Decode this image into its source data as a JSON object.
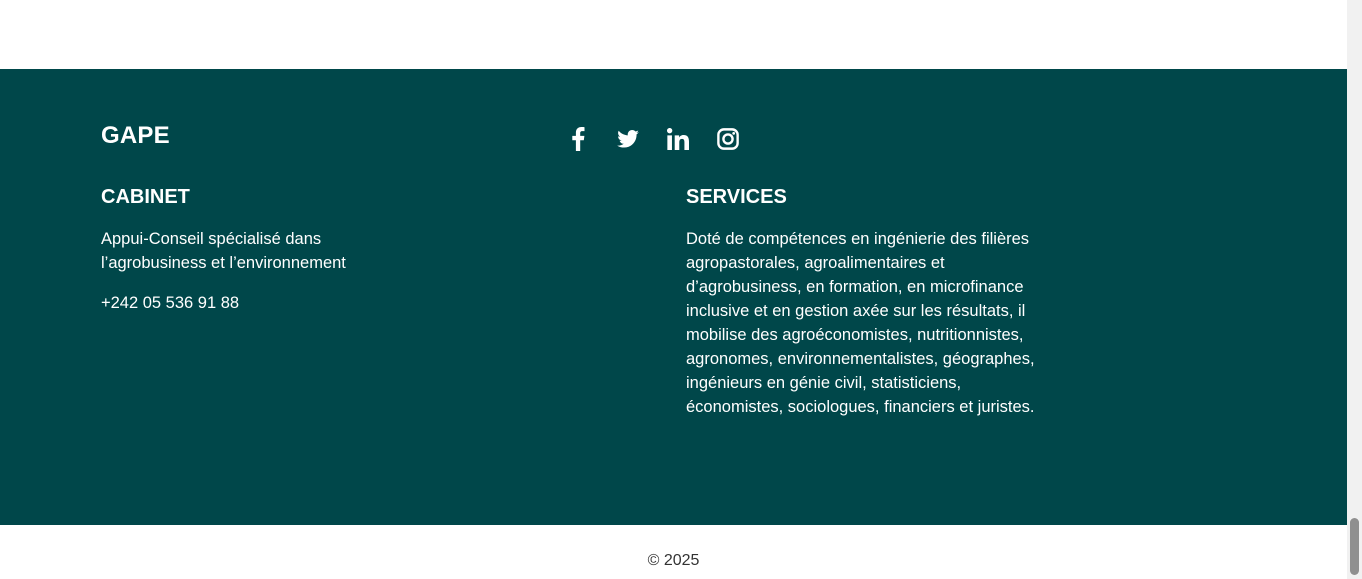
{
  "footer": {
    "brand": "GAPE",
    "socials": [
      {
        "name": "facebook",
        "icon": "facebook-icon"
      },
      {
        "name": "twitter",
        "icon": "twitter-icon"
      },
      {
        "name": "linkedin",
        "icon": "linkedin-icon"
      },
      {
        "name": "instagram",
        "icon": "instagram-icon"
      }
    ],
    "cabinet": {
      "heading": "CABINET",
      "description": "Appui-Conseil spécialisé dans l’agrobusiness et l’environnement",
      "phone": "+242 05 536 91 88"
    },
    "services": {
      "heading": "SERVICES",
      "description": "Doté de compétences en ingénierie des filières agropastorales, agroalimentaires et d’agrobusiness, en formation, en microfinance inclusive et en gestion axée sur les résultats, il mobilise des agroéconomistes, nutritionnistes, agronomes, environnementalistes, géographes, ingénieurs en génie civil, statisticiens, économistes, sociologues, financiers et juristes."
    }
  },
  "bottom": {
    "copyright": "© 2025"
  },
  "colors": {
    "footer_bg": "#00474a",
    "text": "#ffffff"
  }
}
